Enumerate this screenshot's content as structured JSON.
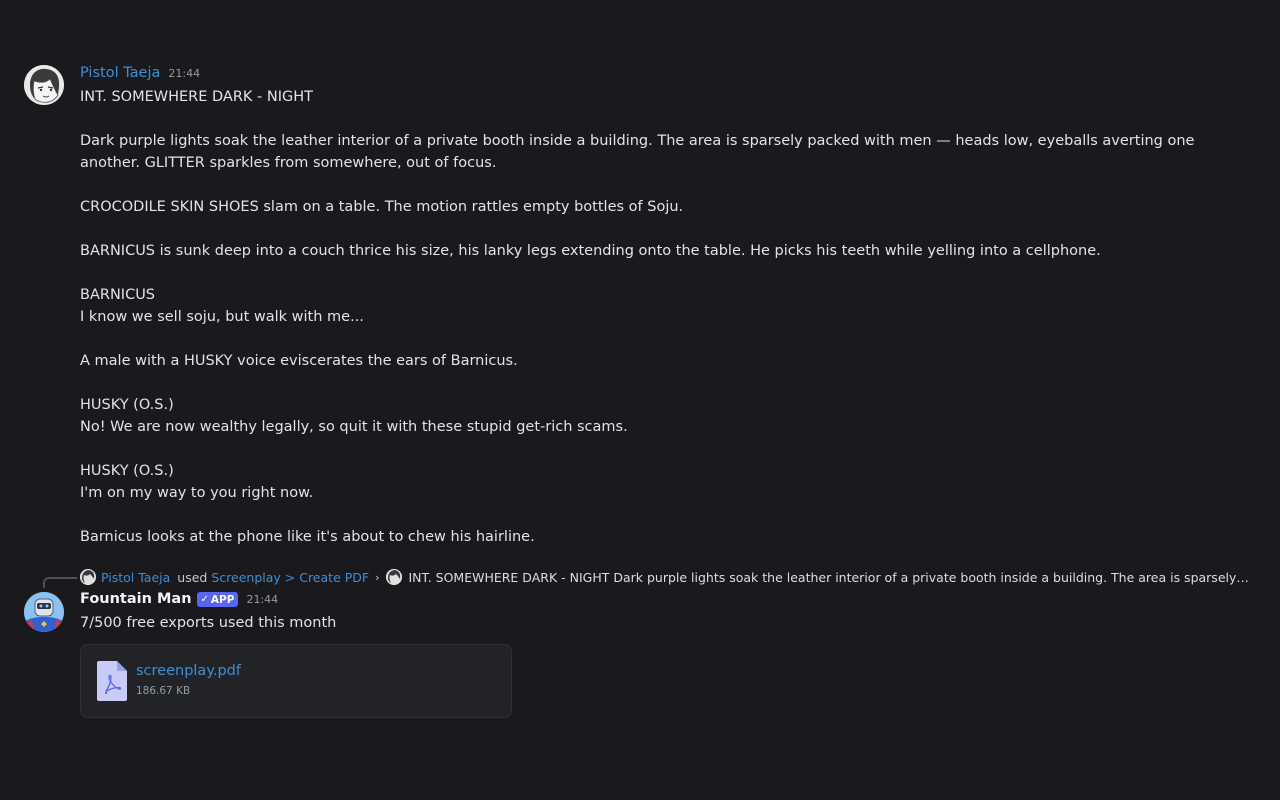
{
  "messages": {
    "first": {
      "author": "Pistol Taeja",
      "time": "21:44",
      "lines": [
        "INT. SOMEWHERE DARK - NIGHT",
        "",
        "Dark purple lights soak the leather interior of a private booth inside a building. The area is sparsely packed with men — heads low, eyeballs averting one another. GLITTER sparkles from somewhere, out of focus.",
        "",
        "CROCODILE SKIN SHOES slam on a table. The motion rattles empty bottles of Soju.",
        "",
        "BARNICUS is sunk deep into a couch thrice his size, his lanky legs extending onto the table. He picks his teeth while yelling into a cellphone.",
        "",
        "BARNICUS",
        "I know we sell soju, but walk with me...",
        "",
        "A male with a HUSKY voice eviscerates the ears of Barnicus.",
        "",
        "HUSKY (O.S.)",
        "No! We are now wealthy legally, so quit it with these stupid get-rich scams.",
        "",
        "HUSKY (O.S.)",
        "I'm on my way to you right now.",
        "",
        "Barnicus looks at the phone like it's about to chew his hairline."
      ]
    },
    "reply": {
      "author": "Pistol Taeja",
      "used": "used",
      "command": "Screenplay > Create PDF",
      "separator": "›",
      "preview": "INT. SOMEWHERE DARK - NIGHT  Dark purple lights soak the leather interior of a private booth inside a building. The area is sparsely packed w..."
    },
    "second": {
      "author": "Fountain Man",
      "badge": "APP",
      "badge_check": "✓",
      "time": "21:44",
      "text": "7/500 free exports used this month",
      "attachment": {
        "name": "screenplay.pdf",
        "size": "186.67 KB"
      }
    }
  },
  "icons": {
    "first_avatar": "manga-face-avatar",
    "second_avatar": "robot-superhero-avatar",
    "file": "pdf-file-icon"
  },
  "colors": {
    "background": "#1a1a1e",
    "link": "#3b8fd6",
    "badge": "#5865f2",
    "attachment_bg": "#222327",
    "file_icon": "#c7cbf5"
  }
}
